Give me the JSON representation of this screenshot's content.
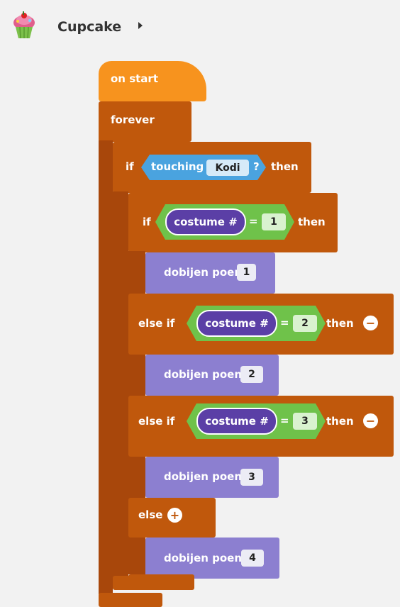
{
  "header": {
    "sprite_name": "Cupcake",
    "expand_icon": "caret-right-icon"
  },
  "colors": {
    "events": "#f7931e",
    "loops": "#c0580c",
    "sensing": "#4aa3df",
    "operators": "#6fc24a",
    "looks": "#8c7fd0",
    "pill": "#5b3fa6"
  },
  "blocks": {
    "on_start": "on start",
    "forever": "forever",
    "outer_if": {
      "if_label": "if",
      "condition": "touching",
      "sprite": "Kodi",
      "question": "?",
      "then_label": "then"
    },
    "inner_if": {
      "if_label": "if",
      "reporter": "costume #",
      "op": "=",
      "value": "1",
      "then_label": "then"
    },
    "say1": {
      "label": "dobijen poen",
      "value": "1"
    },
    "elseif1": {
      "label": "else if",
      "reporter": "costume #",
      "op": "=",
      "value": "2",
      "then_label": "then",
      "remove_icon": "minus-icon"
    },
    "say2": {
      "label": "dobijen poen",
      "value": "2"
    },
    "elseif2": {
      "label": "else if",
      "reporter": "costume #",
      "op": "=",
      "value": "3",
      "then_label": "then",
      "remove_icon": "minus-icon"
    },
    "say3": {
      "label": "dobijen poen",
      "value": "3"
    },
    "else": {
      "label": "else",
      "add_icon": "plus-icon"
    },
    "say4": {
      "label": "dobijen poen",
      "value": "4"
    }
  }
}
